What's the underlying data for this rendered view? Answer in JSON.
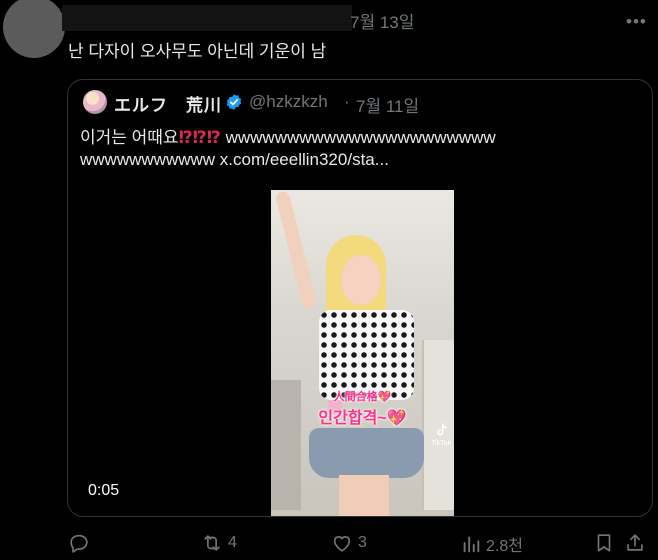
{
  "tweet": {
    "date": "7월 13일",
    "text": "난 다자이 오사무도 아닌데 기운이 남"
  },
  "quote": {
    "display_name": "エルフ　荒川",
    "handle": "@hzkzkzh",
    "dot": "·",
    "date": "7월 11일",
    "line1_prefix": "이거는 어때요",
    "interrobang": "⁉",
    "line1_suffix": " wwwwwwwwwwwwwwwwwwwwww",
    "line2": "wwwwwwwwwww  x.com/eeellin320/sta...",
    "video": {
      "caption_top": "人間合格💖",
      "caption_main": "인간합격~💖",
      "tiktok_label": "TikTok",
      "timestamp": "0:05"
    }
  },
  "actions": {
    "reply": "",
    "retweet_count": "4",
    "like_count": "3",
    "views": "2.8천"
  },
  "colors": {
    "background": "#000000",
    "text": "#e7e9ea",
    "muted": "#71767b",
    "border": "#2f3336",
    "verified": "#1d9bf0",
    "accent_red": "#e0245e"
  },
  "icons": [
    "more-icon",
    "verified-icon",
    "tiktok-icon",
    "reply-icon",
    "retweet-icon",
    "like-icon",
    "views-icon",
    "bookmark-icon",
    "share-icon"
  ]
}
